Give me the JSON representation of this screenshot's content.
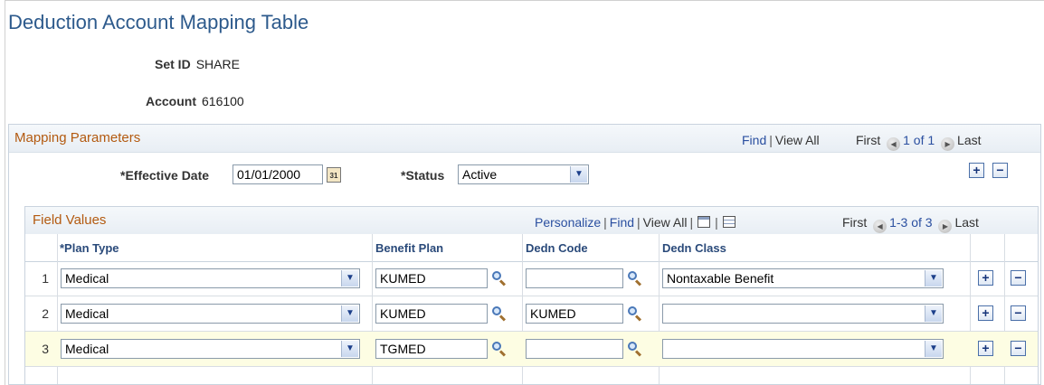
{
  "page": {
    "title": "Deduction Account Mapping Table",
    "setid_label": "Set ID",
    "setid_value": "SHARE",
    "account_label": "Account",
    "account_value": "616100"
  },
  "mapping": {
    "section_title": "Mapping Parameters",
    "find": "Find",
    "view_all": "View All",
    "first": "First",
    "count": "1 of 1",
    "last": "Last",
    "effective_date_label": "*Effective Date",
    "effective_date_value": "01/01/2000",
    "status_label": "*Status",
    "status_value": "Active"
  },
  "field_values": {
    "title": "Field Values",
    "personalize": "Personalize",
    "find": "Find",
    "view_all": "View All",
    "first": "First",
    "count": "1-3 of 3",
    "last": "Last",
    "columns": [
      "*Plan Type",
      "Benefit Plan",
      "Dedn Code",
      "Dedn Class"
    ],
    "rows": [
      {
        "num": "1",
        "plan_type": "Medical",
        "benefit_plan": "KUMED",
        "dedn_code": "",
        "dedn_class": "Nontaxable Benefit"
      },
      {
        "num": "2",
        "plan_type": "Medical",
        "benefit_plan": "KUMED",
        "dedn_code": "KUMED",
        "dedn_class": ""
      },
      {
        "num": "3",
        "plan_type": "Medical",
        "benefit_plan": "TGMED",
        "dedn_code": "",
        "dedn_class": ""
      }
    ]
  },
  "icons": {
    "calendar": "calendar-icon",
    "lookup": "magnifier-icon",
    "dropdown": "chevron-down-icon",
    "add": "plus-icon",
    "delete": "minus-icon",
    "nav_prev": "arrow-left-icon",
    "nav_next": "arrow-right-icon"
  },
  "colors": {
    "title": "#2d5a8c",
    "section_title": "#b35a10",
    "link": "#2a4fa0",
    "highlight_row": "#fdfde3"
  }
}
